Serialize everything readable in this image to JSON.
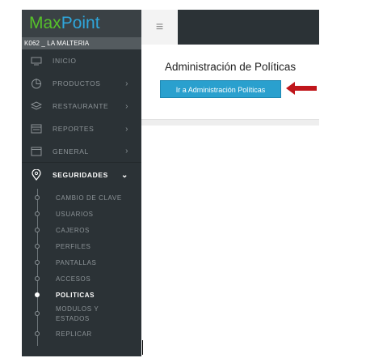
{
  "brand": {
    "part1": "Max",
    "part2": "Point"
  },
  "store": "K062 _ LA MALTERIA",
  "menu": [
    {
      "label": "INICIO",
      "icon": "monitor-icon",
      "has_chevron": false
    },
    {
      "label": "PRODUCTOS",
      "icon": "pie-chart-icon",
      "has_chevron": true
    },
    {
      "label": "RESTAURANTE",
      "icon": "layers-icon",
      "has_chevron": true
    },
    {
      "label": "REPORTES",
      "icon": "report-icon",
      "has_chevron": true
    },
    {
      "label": "GENERAL",
      "icon": "window-icon",
      "has_chevron": true
    }
  ],
  "security": {
    "label": "SEGURIDADES",
    "icon": "location-pin-icon",
    "items": [
      "CAMBIO DE CLAVE",
      "USUARIOS",
      "CAJEROS",
      "PERFILES",
      "PANTALLAS",
      "ACCESOS",
      "POLITICAS",
      "MODULOS Y ESTADOS",
      "REPLICAR"
    ],
    "current": "POLITICAS"
  },
  "topbar": {
    "menu_icon": "hamburger-icon"
  },
  "main": {
    "title": "Administración de Políticas",
    "button_label": "Ir a Administración Políticas",
    "arrow_color": "#c0161b"
  },
  "colors": {
    "sidebar_bg": "#2b3236",
    "brand_max": "#56c12a",
    "brand_point": "#2fa6db",
    "button_bg": "#2aa0ce"
  }
}
